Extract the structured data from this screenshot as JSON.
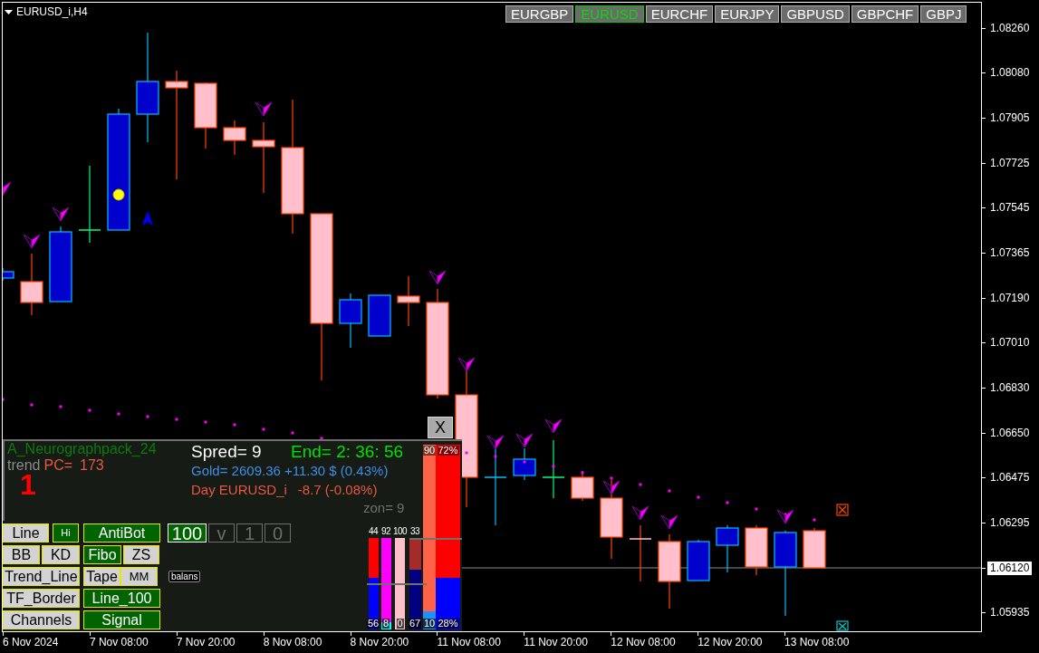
{
  "chart": {
    "title": "EURUSD_i,H4",
    "symbol_tabs": [
      {
        "label": "EURGBP",
        "selected": false
      },
      {
        "label": "EURUSD",
        "selected": true
      },
      {
        "label": "EURCHF",
        "selected": false
      },
      {
        "label": "EURJPY",
        "selected": false
      },
      {
        "label": "GBPUSD",
        "selected": false
      },
      {
        "label": "GBPCHF",
        "selected": false
      },
      {
        "label": "GBPJ",
        "selected": false
      }
    ],
    "close_button": "X"
  },
  "panel": {
    "title": "A_Neurographpack_24",
    "trend_label": "trend",
    "pc_label": "PC=",
    "pc_value": "173",
    "trend_digit": "1",
    "spread": "Spred= 9",
    "timer": "End= 2: 36: 56",
    "gold": "Gold= 2609.36 +11.30 $ (0.43%)",
    "day_label": "Day EURUSD_i",
    "day_change": "-8.7 (-0.08%)",
    "zone": "zon= 9",
    "button_rows": [
      [
        {
          "label": "Line",
          "on": false
        },
        {
          "label": "Hi",
          "on": true
        },
        {
          "label": "AntiBot",
          "on": true
        }
      ],
      [
        {
          "label": "BB",
          "on": false
        },
        {
          "label": "KD",
          "on": false
        },
        {
          "label": "Fibo",
          "on": true
        },
        {
          "label": "ZS",
          "on": false
        }
      ],
      [
        {
          "label": "Trend_Line",
          "on": false
        },
        {
          "label": "Tape",
          "on": false
        },
        {
          "label": "MM",
          "on": false
        }
      ],
      [
        {
          "label": "TF_Border",
          "on": false
        },
        {
          "label": "Line_100",
          "on": true
        }
      ],
      [
        {
          "label": "Channels",
          "on": false
        },
        {
          "label": "Signal",
          "on": true
        }
      ]
    ],
    "value_boxes": [
      {
        "label": "100",
        "selected": true
      },
      {
        "label": "v",
        "selected": false
      },
      {
        "label": "1",
        "selected": false
      },
      {
        "label": "0",
        "selected": false
      }
    ],
    "balance_label": "balans",
    "small_bars": [
      {
        "top_label": "44",
        "bottom_label": "56",
        "color": "#ff0000",
        "fill": {
          "color": "#0000ff",
          "level": 0.56
        }
      },
      {
        "top_label": "92",
        "bottom_label": "8",
        "color": "#ff00ff",
        "fill": {
          "color": "#00ffff",
          "level": 0.08
        }
      },
      {
        "top_label": "100",
        "bottom_label": "0",
        "color": "#ffc0cb"
      },
      {
        "top_label": "33",
        "bottom_label": "67",
        "color": "#a52a2a",
        "fill": {
          "color": "#000080",
          "level": 0.65
        }
      }
    ],
    "large_bars": [
      {
        "top_label": "90",
        "bottom_label": "10",
        "color": "#ff6347",
        "fill": {
          "color": "#1e90ff",
          "level": 0.1
        }
      },
      {
        "top_label": "72%",
        "bottom_label": "28%",
        "color": "#ff0000",
        "fill": {
          "color": "#0000ff",
          "level": 0.28
        }
      }
    ]
  },
  "price_axis": [
    {
      "label": "1.08260",
      "highlighted": false
    },
    {
      "label": "1.08080",
      "highlighted": false
    },
    {
      "label": "1.07905",
      "highlighted": false
    },
    {
      "label": "1.07725",
      "highlighted": false
    },
    {
      "label": "1.07545",
      "highlighted": false
    },
    {
      "label": "1.07365",
      "highlighted": false
    },
    {
      "label": "1.07190",
      "highlighted": false
    },
    {
      "label": "1.07010",
      "highlighted": false
    },
    {
      "label": "1.06830",
      "highlighted": false
    },
    {
      "label": "1.06650",
      "highlighted": false
    },
    {
      "label": "1.06475",
      "highlighted": false
    },
    {
      "label": "1.06295",
      "highlighted": false
    },
    {
      "label": "1.06120",
      "highlighted": true
    },
    {
      "label": "1.05935",
      "highlighted": false
    }
  ],
  "time_axis": [
    "6 Nov 2024",
    "7 Nov 08:00",
    "7 Nov 20:00",
    "8 Nov 08:00",
    "8 Nov 20:00",
    "11 Nov 08:00",
    "11 Nov 20:00",
    "12 Nov 08:00",
    "12 Nov 20:00",
    "13 Nov 08:00"
  ]
}
